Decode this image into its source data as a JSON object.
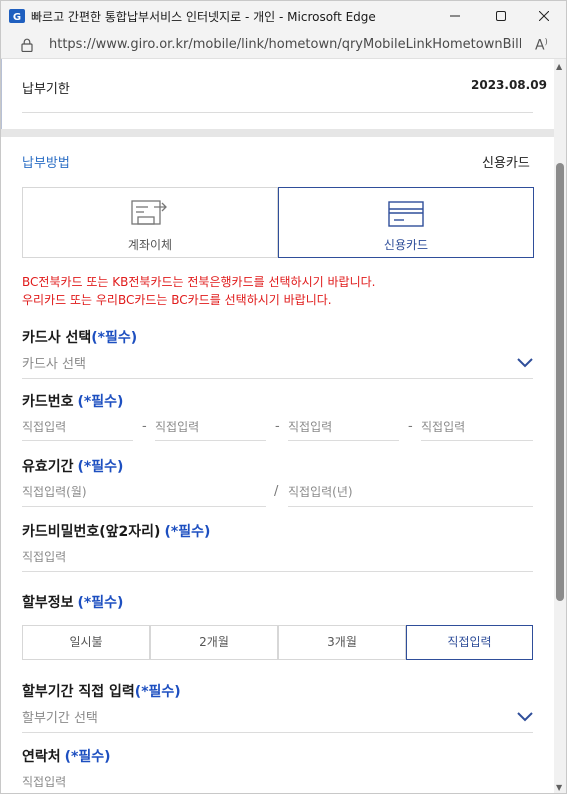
{
  "window": {
    "title": "빠르고 간편한 통합납부서비스 인터넷지로 - 개인 - Microsoft Edge",
    "url": "https://www.giro.or.kr/mobile/link/hometown/qryMobileLinkHometownBillDe..."
  },
  "due": {
    "label": "납부기한",
    "value": "2023.08.09"
  },
  "payment": {
    "section_label": "납부방법",
    "selected_value": "신용카드",
    "methods": [
      {
        "label": "계좌이체",
        "icon": "bank-transfer-icon"
      },
      {
        "label": "신용카드",
        "icon": "credit-card-icon"
      }
    ],
    "warnings": [
      "BC전북카드 또는 KB전북카드는 전북은행카드를 선택하시기 바랍니다.",
      "우리카드 또는 우리BC카드는 BC카드를 선택하시기 바랍니다."
    ]
  },
  "card_company": {
    "label": "카드사 선택",
    "required": "(*필수)",
    "placeholder": "카드사 선택"
  },
  "card_number": {
    "label": "카드번호",
    "required": "(*필수)",
    "placeholders": [
      "직접입력",
      "직접입력",
      "직접입력",
      "직접입력"
    ],
    "separator": "-"
  },
  "expiry": {
    "label": "유효기간",
    "required": "(*필수)",
    "month_placeholder": "직접입력(월)",
    "year_placeholder": "직접입력(년)",
    "separator": "/"
  },
  "password": {
    "label": "카드비밀번호(앞2자리)",
    "required": "(*필수)",
    "placeholder": "직접입력"
  },
  "installment": {
    "label": "할부정보",
    "required": "(*필수)",
    "options": [
      "일시불",
      "2개월",
      "3개월",
      "직접입력"
    ],
    "selected_index": 3
  },
  "installment_direct": {
    "label": "할부기간 직접 입력",
    "required": "(*필수)",
    "placeholder": "할부기간 선택"
  },
  "contact": {
    "label": "연락처",
    "required": "(*필수)",
    "placeholder": "직접입력"
  },
  "colors": {
    "accent": "#2f4e9a",
    "required": "#1d4fc0",
    "warning": "#e01b1b",
    "section": "#2d6fc5"
  }
}
